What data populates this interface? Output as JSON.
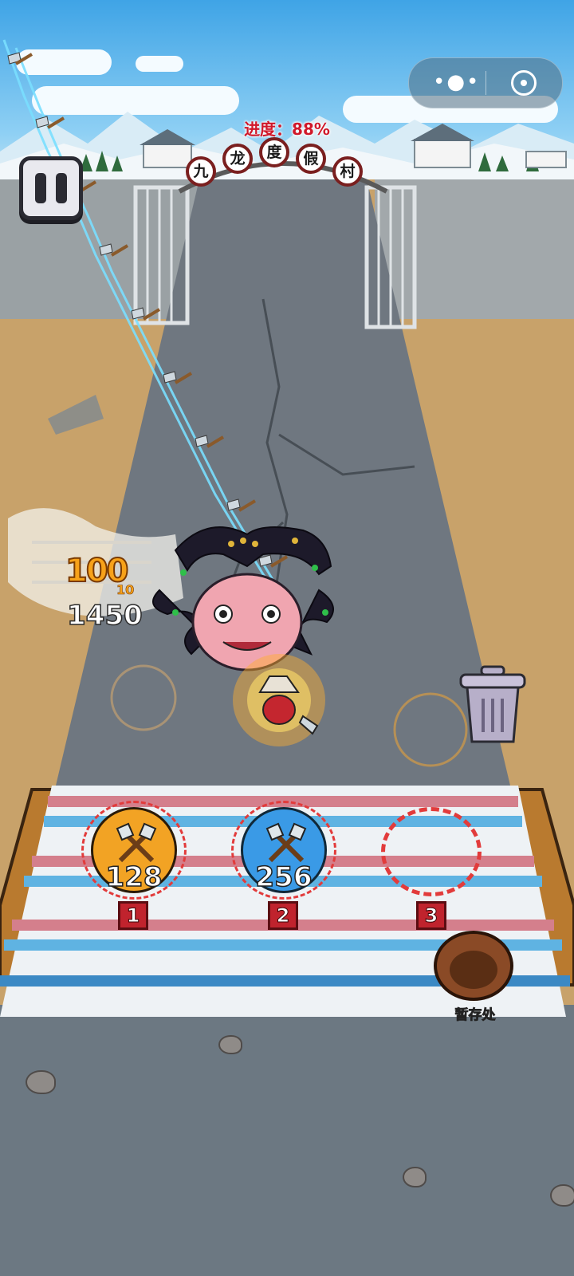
{
  "progress": {
    "label": "进度：88%",
    "value_percent": 88
  },
  "gate_sign": [
    "九",
    "龙",
    "度",
    "假",
    "村"
  ],
  "menu_capsule": {
    "more_glyph": "•●•",
    "close_icon": "target-icon"
  },
  "score_popup": {
    "hit": "100",
    "hit_sub": "10",
    "total": "1450"
  },
  "slots": [
    {
      "tag": "1",
      "value": "128",
      "color": "#f2a324",
      "filled": true
    },
    {
      "tag": "2",
      "value": "256",
      "color": "#3a9ae6",
      "filled": true
    },
    {
      "tag": "3",
      "value": "",
      "color": "",
      "filled": false
    }
  ],
  "storage": {
    "label": "暂存处"
  },
  "colors": {
    "accent_red": "#d0182a",
    "slot_gold": "#f2a324",
    "slot_blue": "#3a9ae6"
  }
}
